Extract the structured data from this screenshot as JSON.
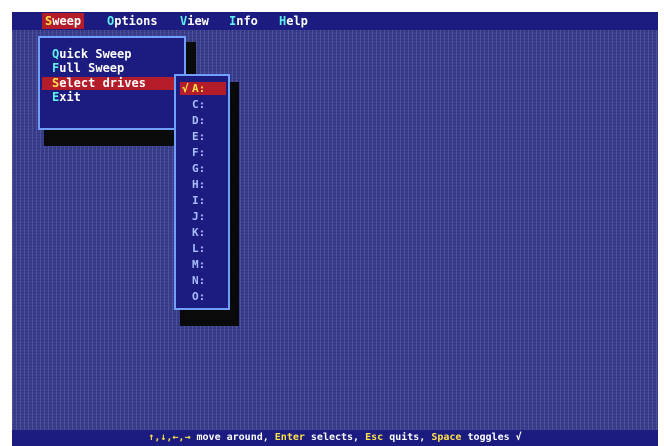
{
  "menubar": {
    "items": [
      {
        "hotkey": "S",
        "rest": "weep"
      },
      {
        "hotkey": "O",
        "rest": "ptions"
      },
      {
        "hotkey": "V",
        "rest": "iew"
      },
      {
        "hotkey": "I",
        "rest": "nfo"
      },
      {
        "hotkey": "H",
        "rest": "elp"
      }
    ]
  },
  "sweep_menu": {
    "items": [
      {
        "hotkey": "Q",
        "rest": "uick Sweep"
      },
      {
        "hotkey": "F",
        "rest": "ull Sweep"
      },
      {
        "hotkey": "S",
        "rest": "elect drives"
      },
      {
        "hotkey": "E",
        "rest": "xit"
      }
    ]
  },
  "drives_menu": {
    "items": [
      {
        "check": "√",
        "label": "A:"
      },
      {
        "check": "",
        "label": "C:"
      },
      {
        "check": "",
        "label": "D:"
      },
      {
        "check": "",
        "label": "E:"
      },
      {
        "check": "",
        "label": "F:"
      },
      {
        "check": "",
        "label": "G:"
      },
      {
        "check": "",
        "label": "H:"
      },
      {
        "check": "",
        "label": "I:"
      },
      {
        "check": "",
        "label": "J:"
      },
      {
        "check": "",
        "label": "K:"
      },
      {
        "check": "",
        "label": "L:"
      },
      {
        "check": "",
        "label": "M:"
      },
      {
        "check": "",
        "label": "N:"
      },
      {
        "check": "",
        "label": "O:"
      }
    ]
  },
  "statusbar": {
    "keys": "↑,↓,←,→",
    "t1": " move around, ",
    "enter": "Enter",
    "t2": " selects, ",
    "esc": "Esc",
    "t3": " quits, ",
    "space": "Space",
    "t4": " toggles √"
  },
  "colors": {
    "desktop": "#3a3e8e",
    "menu_bg": "#1c1c80",
    "highlight": "#b51c2a",
    "hotkey": "#5cf0f0",
    "selected_hotkey": "#ffe24a"
  }
}
